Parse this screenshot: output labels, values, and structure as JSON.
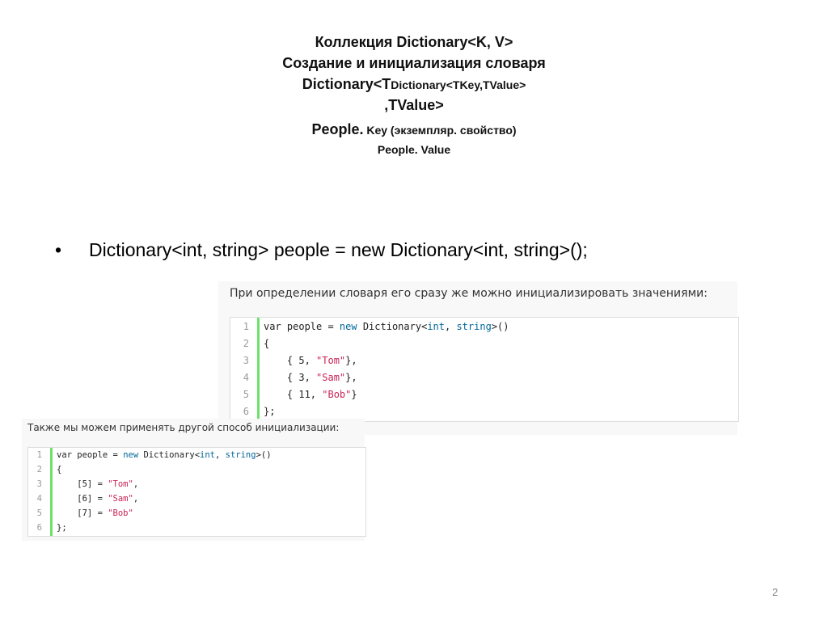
{
  "title": {
    "line1": "Коллекция Dictionary<K, V>",
    "line2": "Создание и инициализация словаря",
    "line3a": "Dictionary<T",
    "line3b": "Dictionary<TKey,TValue>",
    "line4": ",TValue>",
    "line5a": "People.",
    "line5b": " Key (экземпляр. свойство)",
    "line6": "People. Value"
  },
  "bullet": {
    "marker": "•",
    "text": "Dictionary<int, string> people = new Dictionary<int, string>();"
  },
  "screenshot1": {
    "caption": "При определении словаря его сразу же можно инициализировать значениями:",
    "lines": [
      [
        {
          "t": "var people = "
        },
        {
          "t": "new",
          "c": "kw"
        },
        {
          "t": " Dictionary<"
        },
        {
          "t": "int",
          "c": "ty"
        },
        {
          "t": ", "
        },
        {
          "t": "string",
          "c": "ty"
        },
        {
          "t": ">()"
        }
      ],
      [
        {
          "t": "{"
        }
      ],
      [
        {
          "t": "    { 5, "
        },
        {
          "t": "\"Tom\"",
          "c": "str"
        },
        {
          "t": "},"
        }
      ],
      [
        {
          "t": "    { 3, "
        },
        {
          "t": "\"Sam\"",
          "c": "str"
        },
        {
          "t": "},"
        }
      ],
      [
        {
          "t": "    { 11, "
        },
        {
          "t": "\"Bob\"",
          "c": "str"
        },
        {
          "t": "}"
        }
      ],
      [
        {
          "t": "};"
        }
      ]
    ]
  },
  "screenshot2": {
    "caption": "Также мы можем применять другой способ инициализации:",
    "lines": [
      [
        {
          "t": "var people = "
        },
        {
          "t": "new",
          "c": "kw"
        },
        {
          "t": " Dictionary<"
        },
        {
          "t": "int",
          "c": "ty"
        },
        {
          "t": ", "
        },
        {
          "t": "string",
          "c": "ty"
        },
        {
          "t": ">()"
        }
      ],
      [
        {
          "t": "{"
        }
      ],
      [
        {
          "t": "    [5] = "
        },
        {
          "t": "\"Tom\"",
          "c": "str"
        },
        {
          "t": ","
        }
      ],
      [
        {
          "t": "    [6] = "
        },
        {
          "t": "\"Sam\"",
          "c": "str"
        },
        {
          "t": ","
        }
      ],
      [
        {
          "t": "    [7] = "
        },
        {
          "t": "\"Bob\"",
          "c": "str"
        }
      ],
      [
        {
          "t": "};"
        }
      ]
    ]
  },
  "page_number": "2"
}
